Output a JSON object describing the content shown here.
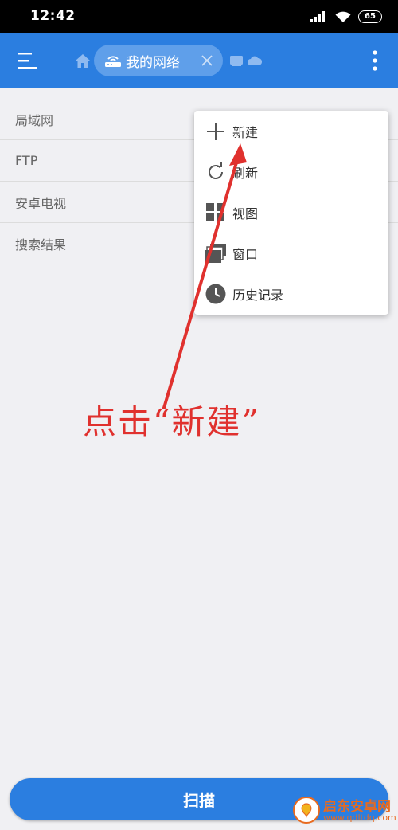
{
  "status_bar": {
    "time": "12:42",
    "battery": "65"
  },
  "app_bar": {
    "network_chip_label": "我的网络",
    "icons": [
      "menu-icon",
      "home-icon",
      "router-icon",
      "close-icon",
      "device-icon",
      "cloud-icon",
      "more-vert-icon"
    ]
  },
  "list": {
    "items": [
      "局域网",
      "FTP",
      "安卓电视",
      "搜索结果"
    ]
  },
  "popup_menu": {
    "items": [
      {
        "label": "新建",
        "icon": "plus-icon"
      },
      {
        "label": "刷新",
        "icon": "refresh-icon"
      },
      {
        "label": "视图",
        "icon": "grid-icon"
      },
      {
        "label": "窗口",
        "icon": "windows-icon"
      },
      {
        "label": "历史记录",
        "icon": "clock-icon"
      }
    ]
  },
  "annotation": {
    "text": "点击“新建”",
    "color": "#e0312e"
  },
  "bottom": {
    "scan_label": "扫描"
  },
  "watermark": {
    "title": "启东安卓网",
    "url": "www.qdltdq.com"
  },
  "colors": {
    "primary": "#2b7ee0",
    "background": "#f0f0f3"
  }
}
